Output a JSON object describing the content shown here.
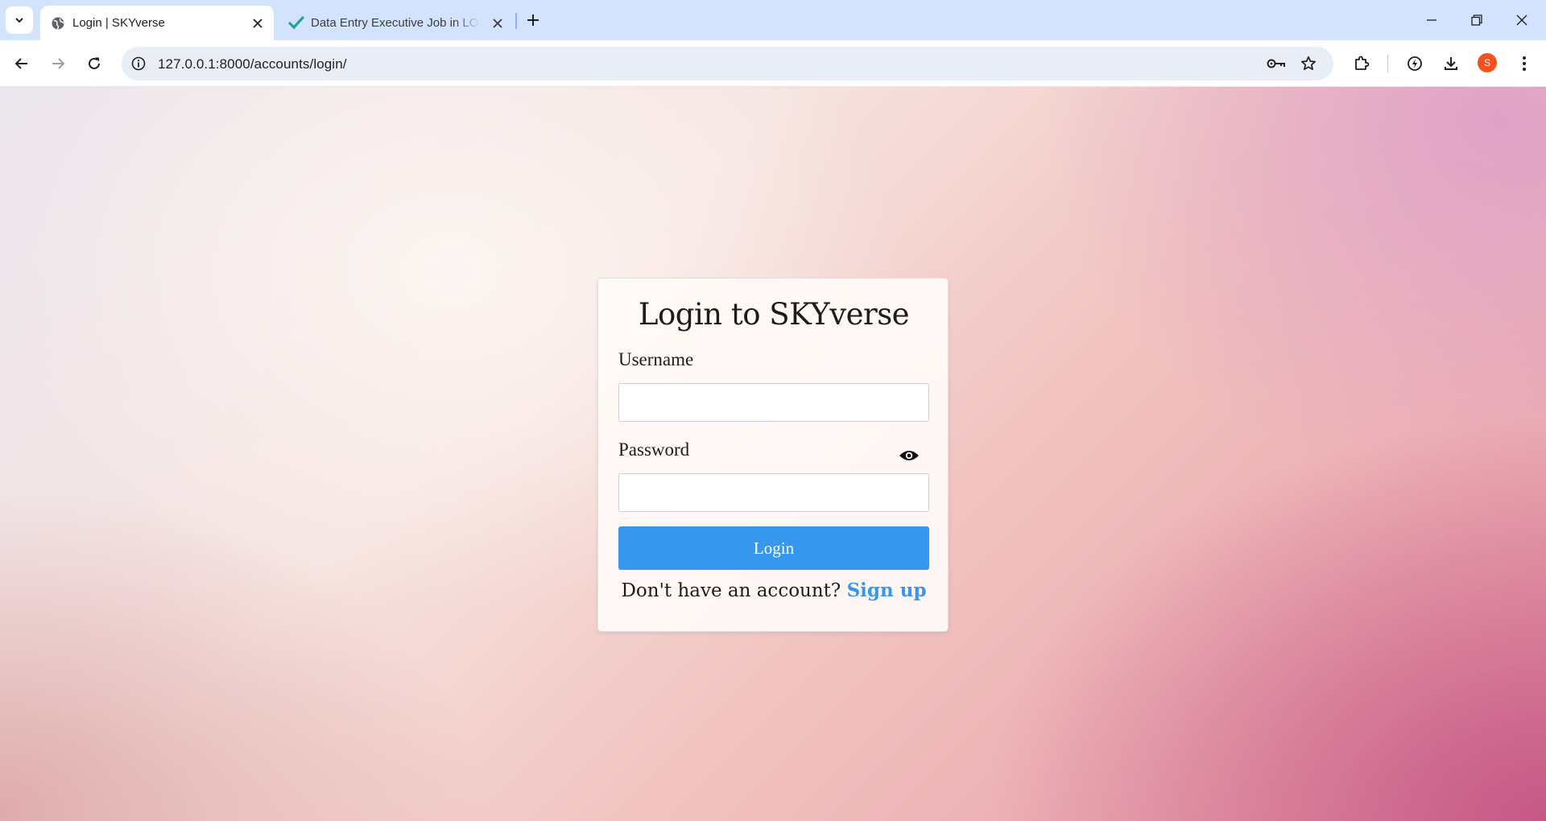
{
  "browser": {
    "tabs": [
      {
        "title": "Login | SKYverse",
        "active": true,
        "icon": "globe-icon"
      },
      {
        "title": "Data Entry Executive Job in LOA",
        "active": false,
        "icon": "checkmark-icon"
      }
    ],
    "url": "127.0.0.1:8000/accounts/login/",
    "profile_initial": "S",
    "profile_color": "#f4511e"
  },
  "login": {
    "heading": "Login to SKYverse",
    "username_label": "Username",
    "username_value": "",
    "password_label": "Password",
    "password_value": "",
    "submit_label": "Login",
    "signup_prompt": "Don't have an account?",
    "signup_link": "Sign up"
  },
  "colors": {
    "accent": "#3797ef",
    "tab_strip": "#d3e3fd"
  }
}
